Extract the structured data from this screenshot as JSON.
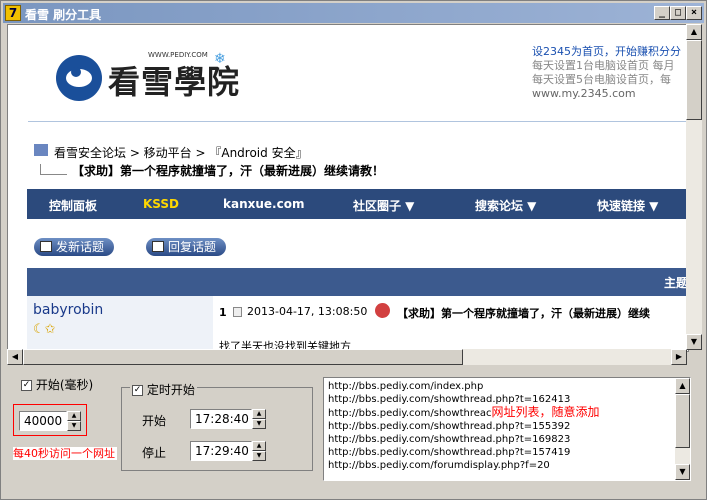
{
  "window": {
    "title": "看雪 刷分工具",
    "app_icon": "7",
    "min": "_",
    "max": "□",
    "close": "×"
  },
  "browser": {
    "logo": {
      "site": "WWW.PEDIY.COM",
      "name": "看雪學院"
    },
    "ad": {
      "line1": "设2345为首页，开始赚积分分",
      "line2": "每天设置1台电脑设首页  每月",
      "line3": "每天设置5台电脑设首页，每",
      "line4": "www.my.2345.com"
    },
    "breadcrumb": {
      "path": "看雪安全论坛 > 移动平台 > 『Android 安全』",
      "thread": "【求助】第一个程序就撞墙了，汗（最新进展）继续请教！"
    },
    "nav": [
      "控制面板",
      "KSSD",
      "kanxue.com",
      "社区圈子 ▼",
      "搜索论坛 ▼",
      "快速链接 ▼"
    ],
    "buttons": {
      "new_topic": "发新话题",
      "reply": "回复话题"
    },
    "table_header": "主题",
    "post": {
      "user": "babyrobin",
      "user_badges": "☾✩",
      "number": "1",
      "date": "2013-04-17, 13:08:50",
      "title": "【求助】第一个程序就撞墙了，汗（最新进展）继续",
      "body": "找了半天也没找到关键地方"
    }
  },
  "controls": {
    "start_label": "开始(毫秒)",
    "interval_value": "40000",
    "interval_note": "每40秒访问一个网址",
    "timer_label": "定时开始",
    "start_time_label": "开始",
    "start_time_value": "17:28:40",
    "stop_time_label": "停止",
    "stop_time_value": "17:29:40",
    "url_note": "网址列表，随意添加",
    "urls": [
      "http://bbs.pediy.com/index.php",
      "http://bbs.pediy.com/showthread.php?t=162413",
      "http://bbs.pediy.com/showthreac",
      "http://bbs.pediy.com/showthread.php?t=155392",
      "http://bbs.pediy.com/showthread.php?t=169823",
      "http://bbs.pediy.com/showthread.php?t=157419",
      "http://bbs.pediy.com/forumdisplay.php?f=20"
    ]
  }
}
